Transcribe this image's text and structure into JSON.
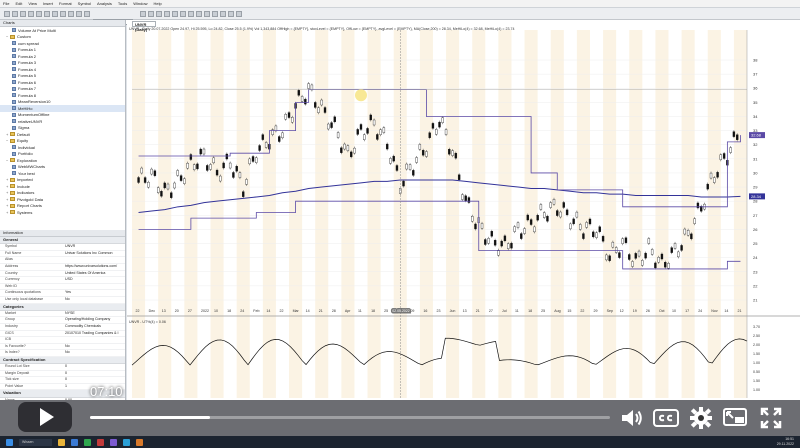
{
  "menu": [
    "File",
    "Edit",
    "View",
    "Insert",
    "Format",
    "Symbol",
    "Analysis",
    "Tools",
    "Window",
    "Help"
  ],
  "toolbar": {
    "symbol_value": "UNVR"
  },
  "navigator": {
    "title": "Charts",
    "items": [
      {
        "label": "Volume At Price Multi",
        "type": "formula",
        "indent": 2
      },
      {
        "label": "Custom",
        "type": "folder",
        "indent": 1,
        "expander": "−"
      },
      {
        "label": "cum spread",
        "type": "formula",
        "indent": 2
      },
      {
        "label": "Formula 1",
        "type": "formula",
        "indent": 2
      },
      {
        "label": "Formula 2",
        "type": "formula",
        "indent": 2
      },
      {
        "label": "Formula 3",
        "type": "formula",
        "indent": 2
      },
      {
        "label": "Formula 4",
        "type": "formula",
        "indent": 2
      },
      {
        "label": "Formula 5",
        "type": "formula",
        "indent": 2
      },
      {
        "label": "Formula 6",
        "type": "formula",
        "indent": 2
      },
      {
        "label": "Formula 7",
        "type": "formula",
        "indent": 2
      },
      {
        "label": "Formula 8",
        "type": "formula",
        "indent": 2
      },
      {
        "label": "MeanReversion10",
        "type": "formula",
        "indent": 2
      },
      {
        "label": "MeHiHo",
        "type": "formula",
        "indent": 2,
        "selected": true
      },
      {
        "label": "MomentumOffline",
        "type": "formula",
        "indent": 2
      },
      {
        "label": "relativeUNVR",
        "type": "formula",
        "indent": 2
      },
      {
        "label": "Sigma",
        "type": "formula",
        "indent": 2
      },
      {
        "label": "Default",
        "type": "folder",
        "indent": 1,
        "expander": "+"
      },
      {
        "label": "Equity",
        "type": "folder",
        "indent": 1,
        "expander": "−"
      },
      {
        "label": "Individual",
        "type": "formula",
        "indent": 2
      },
      {
        "label": "Portfolio",
        "type": "formula",
        "indent": 2
      },
      {
        "label": "Exploration",
        "type": "folder",
        "indent": 1,
        "expander": "−"
      },
      {
        "label": "WebMWCharts",
        "type": "formula",
        "indent": 2
      },
      {
        "label": "Your best",
        "type": "formula",
        "indent": 2
      },
      {
        "label": "Imported",
        "type": "folder",
        "indent": 1,
        "expander": "+"
      },
      {
        "label": "Include",
        "type": "folder",
        "indent": 1,
        "expander": "+"
      },
      {
        "label": "Indicators",
        "type": "folder",
        "indent": 1,
        "expander": "+"
      },
      {
        "label": "Pivotgold Data",
        "type": "folder",
        "indent": 1,
        "expander": "+"
      },
      {
        "label": "Report Charts",
        "type": "folder",
        "indent": 1,
        "expander": "+"
      },
      {
        "label": "Systems",
        "type": "folder",
        "indent": 1,
        "expander": "+"
      }
    ],
    "tabs": [
      "Symbols",
      "Layouts",
      "Charts"
    ]
  },
  "info": {
    "title": "Information",
    "sections": [
      {
        "title": "General",
        "rows": [
          [
            "Symbol",
            "UNVR"
          ],
          [
            "Full Name",
            "Univar Solutions Inc Common"
          ],
          [
            "Alias",
            ""
          ],
          [
            "Address",
            "https://www.univarsolutions.com/"
          ],
          [
            "Country",
            "United States Of America"
          ],
          [
            "Currency",
            "USD"
          ],
          [
            "Web ID",
            ""
          ],
          [
            "Continuous quotations",
            "Yes"
          ],
          [
            "Use only local database",
            "No"
          ]
        ]
      },
      {
        "title": "Categories",
        "rows": [
          [
            "Market",
            "NYSE"
          ],
          [
            "Group",
            "Operating/Holding Company"
          ],
          [
            "Industry",
            "Commodity Chemicals"
          ],
          [
            "GICS",
            "20107010 Trading Companies & I"
          ],
          [
            "ICB",
            ""
          ],
          [
            "Is Favourite?",
            "No"
          ],
          [
            "Is Index?",
            "No"
          ]
        ]
      },
      {
        "title": "Contract Specification",
        "rows": [
          [
            "Round Lot Size",
            "0"
          ],
          [
            "Margin Deposit",
            "0"
          ],
          [
            "Tick size",
            "0"
          ],
          [
            "Point Value",
            "1"
          ]
        ]
      },
      {
        "title": "Valuation",
        "rows": [
          [
            "Name",
            "0.00"
          ],
          [
            "Forward P/E",
            "N/A"
          ]
        ]
      }
    ]
  },
  "chart": {
    "tab_label": "UNVR (Daily)",
    "header": "UNVR - Daily 20.07.2022 Open 24.97, Hi 25.595, Lo 24.82, Close 25.5 (1.9%) Vol 1,343,884 OffHigh = {EMPTY}, stoxLevel = {EMPTY}, OffLow = {EMPTY}, avgLevel = {EMPTY}, MA(Close,200) = 28.34, MeHiLo(4) = 32.68, MeHiLo(4) = 23.74",
    "oscillator_header": "UNVR - UT%(4) = 0.06",
    "price_labels": [
      "38",
      "37",
      "36",
      "35",
      "34",
      "33",
      "32",
      "31",
      "30",
      "29",
      "28",
      "27",
      "26",
      "25",
      "24",
      "23",
      "22",
      "21"
    ],
    "osc_labels": [
      "3.70",
      "2.50",
      "2.00",
      "1.50",
      "1.00",
      "0.50",
      "1.50",
      "1.00"
    ],
    "date_labels": [
      "22",
      "Dec",
      "13",
      "20",
      "27",
      "2022",
      "10",
      "18",
      "24",
      "Feb",
      "14",
      "22",
      "Mar",
      "14",
      "21",
      "28",
      "Apr",
      "11",
      "18",
      "25",
      "May",
      "09",
      "16",
      "23",
      "Jun",
      "13",
      "21",
      "27",
      "Jul",
      "11",
      "18",
      "25",
      "Aug",
      "15",
      "22",
      "29",
      "Sep",
      "12",
      "19",
      "26",
      "Oct",
      "10",
      "17",
      "24",
      "Nov",
      "14",
      "21"
    ],
    "cursor_date": "02.05.2022",
    "highlighted_price": "32.68",
    "ma_price": "28.34"
  },
  "chart_data": {
    "type": "line",
    "title": "UNVR (Daily)",
    "xlabel": "",
    "ylabel": "",
    "ylim": [
      21,
      38
    ],
    "x": [
      "22",
      "Dec",
      "13",
      "20",
      "27",
      "2022",
      "10",
      "18",
      "24",
      "Feb",
      "14",
      "22",
      "Mar",
      "14",
      "21",
      "28",
      "Apr",
      "11",
      "18",
      "25",
      "May",
      "09",
      "16",
      "23",
      "Jun",
      "13",
      "21",
      "27",
      "Jul",
      "11",
      "18",
      "25",
      "Aug",
      "15",
      "22",
      "29",
      "Sep",
      "12",
      "19",
      "26",
      "Oct",
      "10",
      "17",
      "24",
      "Nov",
      "14",
      "21"
    ],
    "series": [
      {
        "name": "Close",
        "values": [
          29.5,
          29.8,
          28.6,
          29.4,
          30.6,
          31.2,
          30.0,
          30.8,
          29.0,
          31.5,
          32.4,
          33.0,
          34.8,
          35.9,
          34.5,
          33.2,
          31.2,
          32.9,
          33.5,
          32.1,
          29.2,
          30.6,
          31.9,
          33.8,
          31.5,
          28.0,
          26.2,
          25.1,
          24.8,
          25.9,
          26.4,
          27.2,
          27.6,
          26.8,
          26.1,
          26.0,
          24.1,
          25.0,
          23.7,
          24.6,
          23.5,
          24.4,
          25.6,
          27.6,
          29.9,
          31.3,
          33.0
        ],
        "color": "#111111"
      },
      {
        "name": "MA(Close,200)",
        "values": [
          27.2,
          27.3,
          27.4,
          27.6,
          27.7,
          27.9,
          28.0,
          28.1,
          28.2,
          28.3,
          28.4,
          28.6,
          28.7,
          28.9,
          29.0,
          29.1,
          29.2,
          29.3,
          29.4,
          29.4,
          29.5,
          29.5,
          29.5,
          29.5,
          29.5,
          29.4,
          29.3,
          29.2,
          29.1,
          29.0,
          28.9,
          28.9,
          28.8,
          28.7,
          28.6,
          28.6,
          28.5,
          28.5,
          28.4,
          28.4,
          28.4,
          28.4,
          28.4,
          28.3,
          28.3,
          28.3,
          28.34
        ],
        "color": "#333399"
      },
      {
        "name": "MeHiLo upper",
        "values": [
          31.2,
          31.2,
          31.2,
          31.2,
          31.2,
          31.2,
          31.2,
          31.4,
          31.4,
          31.4,
          33.0,
          33.0,
          35.0,
          35.9,
          35.9,
          35.9,
          35.9,
          35.9,
          35.9,
          35.9,
          35.9,
          35.9,
          34.0,
          34.0,
          34.0,
          34.0,
          34.0,
          34.0,
          34.0,
          34.0,
          30.0,
          30.0,
          28.8,
          28.8,
          28.8,
          28.8,
          28.8,
          27.6,
          27.6,
          27.6,
          27.6,
          27.6,
          27.6,
          27.6,
          27.6,
          32.2,
          32.68
        ],
        "color": "#5b4aa6"
      },
      {
        "name": "MeHiLo lower",
        "values": [
          26.0,
          26.0,
          26.0,
          26.0,
          26.8,
          26.8,
          26.8,
          26.8,
          26.8,
          27.2,
          27.2,
          27.2,
          28.0,
          28.0,
          28.0,
          28.0,
          28.0,
          28.0,
          28.0,
          28.0,
          28.0,
          28.0,
          28.0,
          28.0,
          28.0,
          28.0,
          24.5,
          24.5,
          24.5,
          24.5,
          24.5,
          24.5,
          24.5,
          24.5,
          24.5,
          24.5,
          24.5,
          23.2,
          23.2,
          23.2,
          23.2,
          23.2,
          23.2,
          23.2,
          23.2,
          23.74,
          23.74
        ],
        "color": "#5b4aa6"
      }
    ],
    "grid": true,
    "legend": "none"
  },
  "video": {
    "time": "07:10",
    "progress": 0.23
  },
  "taskbar": {
    "search_placeholder": "Wissen",
    "clock_time": "16:51",
    "clock_date": "29.11.2022"
  }
}
